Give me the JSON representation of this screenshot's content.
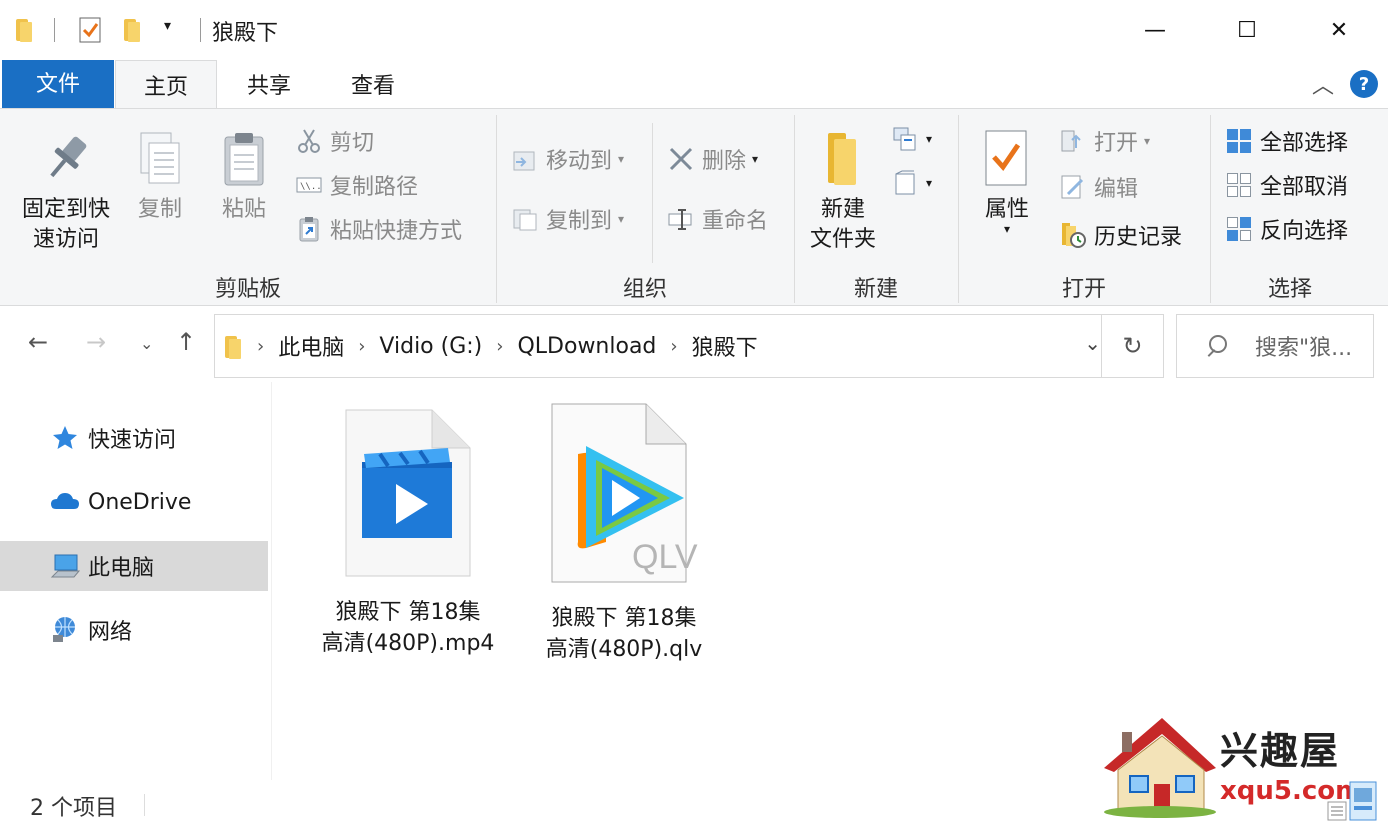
{
  "window": {
    "title": "狼殿下",
    "minimize": "—",
    "maximize": "☐",
    "close": "✕"
  },
  "ribbon_tabs": [
    "文件",
    "主页",
    "共享",
    "查看"
  ],
  "ribbon": {
    "clipboard": {
      "pin": "固定到快\n速访问",
      "pin_line1": "固定到快",
      "pin_line2": "速访问",
      "copy": "复制",
      "paste": "粘贴",
      "cut": "剪切",
      "copy_path": "复制路径",
      "paste_shortcut": "粘贴快捷方式",
      "label": "剪贴板"
    },
    "organize": {
      "move_to": "移动到",
      "copy_to": "复制到",
      "delete": "删除",
      "rename": "重命名",
      "label": "组织"
    },
    "new": {
      "new_folder_line1": "新建",
      "new_folder_line2": "文件夹",
      "label": "新建"
    },
    "open": {
      "properties": "属性",
      "open": "打开",
      "edit": "编辑",
      "history": "历史记录",
      "label": "打开"
    },
    "select": {
      "select_all": "全部选择",
      "select_none": "全部取消",
      "invert": "反向选择",
      "label": "选择"
    }
  },
  "address": {
    "crumbs": [
      "此电脑",
      "Vidio (G:)",
      "QLDownload",
      "狼殿下"
    ],
    "search_placeholder": "搜索\"狼..."
  },
  "nav": {
    "items": [
      "快速访问",
      "OneDrive",
      "此电脑",
      "网络"
    ],
    "selected": "此电脑"
  },
  "files": [
    {
      "line1": "狼殿下 第18集",
      "line2": "高清(480P).mp4",
      "icon": "video-file-icon"
    },
    {
      "line1": "狼殿下 第18集",
      "line2": "高清(480P).qlv",
      "icon": "qlv-file-icon",
      "badge": "QLV"
    }
  ],
  "status": {
    "count": "2 个项目"
  },
  "watermark": {
    "name": "兴趣屋",
    "url": "xqu5.com"
  },
  "colors": {
    "accent": "#1a6fc4",
    "folder": "#f0c24b",
    "selected_nav": "#d9d9d9"
  }
}
